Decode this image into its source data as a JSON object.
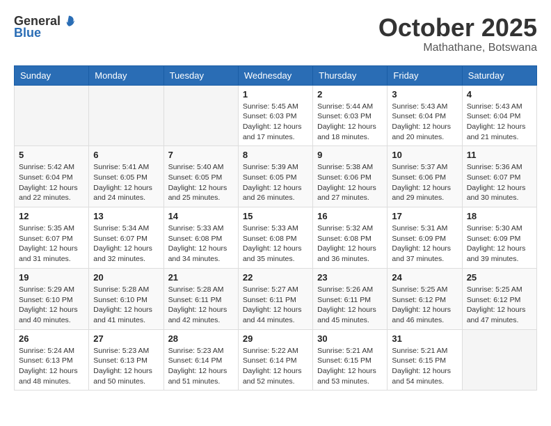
{
  "header": {
    "logo_general": "General",
    "logo_blue": "Blue",
    "month": "October 2025",
    "location": "Mathathane, Botswana"
  },
  "weekdays": [
    "Sunday",
    "Monday",
    "Tuesday",
    "Wednesday",
    "Thursday",
    "Friday",
    "Saturday"
  ],
  "weeks": [
    [
      {
        "day": "",
        "info": ""
      },
      {
        "day": "",
        "info": ""
      },
      {
        "day": "",
        "info": ""
      },
      {
        "day": "1",
        "info": "Sunrise: 5:45 AM\nSunset: 6:03 PM\nDaylight: 12 hours\nand 17 minutes."
      },
      {
        "day": "2",
        "info": "Sunrise: 5:44 AM\nSunset: 6:03 PM\nDaylight: 12 hours\nand 18 minutes."
      },
      {
        "day": "3",
        "info": "Sunrise: 5:43 AM\nSunset: 6:04 PM\nDaylight: 12 hours\nand 20 minutes."
      },
      {
        "day": "4",
        "info": "Sunrise: 5:43 AM\nSunset: 6:04 PM\nDaylight: 12 hours\nand 21 minutes."
      }
    ],
    [
      {
        "day": "5",
        "info": "Sunrise: 5:42 AM\nSunset: 6:04 PM\nDaylight: 12 hours\nand 22 minutes."
      },
      {
        "day": "6",
        "info": "Sunrise: 5:41 AM\nSunset: 6:05 PM\nDaylight: 12 hours\nand 24 minutes."
      },
      {
        "day": "7",
        "info": "Sunrise: 5:40 AM\nSunset: 6:05 PM\nDaylight: 12 hours\nand 25 minutes."
      },
      {
        "day": "8",
        "info": "Sunrise: 5:39 AM\nSunset: 6:05 PM\nDaylight: 12 hours\nand 26 minutes."
      },
      {
        "day": "9",
        "info": "Sunrise: 5:38 AM\nSunset: 6:06 PM\nDaylight: 12 hours\nand 27 minutes."
      },
      {
        "day": "10",
        "info": "Sunrise: 5:37 AM\nSunset: 6:06 PM\nDaylight: 12 hours\nand 29 minutes."
      },
      {
        "day": "11",
        "info": "Sunrise: 5:36 AM\nSunset: 6:07 PM\nDaylight: 12 hours\nand 30 minutes."
      }
    ],
    [
      {
        "day": "12",
        "info": "Sunrise: 5:35 AM\nSunset: 6:07 PM\nDaylight: 12 hours\nand 31 minutes."
      },
      {
        "day": "13",
        "info": "Sunrise: 5:34 AM\nSunset: 6:07 PM\nDaylight: 12 hours\nand 32 minutes."
      },
      {
        "day": "14",
        "info": "Sunrise: 5:33 AM\nSunset: 6:08 PM\nDaylight: 12 hours\nand 34 minutes."
      },
      {
        "day": "15",
        "info": "Sunrise: 5:33 AM\nSunset: 6:08 PM\nDaylight: 12 hours\nand 35 minutes."
      },
      {
        "day": "16",
        "info": "Sunrise: 5:32 AM\nSunset: 6:08 PM\nDaylight: 12 hours\nand 36 minutes."
      },
      {
        "day": "17",
        "info": "Sunrise: 5:31 AM\nSunset: 6:09 PM\nDaylight: 12 hours\nand 37 minutes."
      },
      {
        "day": "18",
        "info": "Sunrise: 5:30 AM\nSunset: 6:09 PM\nDaylight: 12 hours\nand 39 minutes."
      }
    ],
    [
      {
        "day": "19",
        "info": "Sunrise: 5:29 AM\nSunset: 6:10 PM\nDaylight: 12 hours\nand 40 minutes."
      },
      {
        "day": "20",
        "info": "Sunrise: 5:28 AM\nSunset: 6:10 PM\nDaylight: 12 hours\nand 41 minutes."
      },
      {
        "day": "21",
        "info": "Sunrise: 5:28 AM\nSunset: 6:11 PM\nDaylight: 12 hours\nand 42 minutes."
      },
      {
        "day": "22",
        "info": "Sunrise: 5:27 AM\nSunset: 6:11 PM\nDaylight: 12 hours\nand 44 minutes."
      },
      {
        "day": "23",
        "info": "Sunrise: 5:26 AM\nSunset: 6:11 PM\nDaylight: 12 hours\nand 45 minutes."
      },
      {
        "day": "24",
        "info": "Sunrise: 5:25 AM\nSunset: 6:12 PM\nDaylight: 12 hours\nand 46 minutes."
      },
      {
        "day": "25",
        "info": "Sunrise: 5:25 AM\nSunset: 6:12 PM\nDaylight: 12 hours\nand 47 minutes."
      }
    ],
    [
      {
        "day": "26",
        "info": "Sunrise: 5:24 AM\nSunset: 6:13 PM\nDaylight: 12 hours\nand 48 minutes."
      },
      {
        "day": "27",
        "info": "Sunrise: 5:23 AM\nSunset: 6:13 PM\nDaylight: 12 hours\nand 50 minutes."
      },
      {
        "day": "28",
        "info": "Sunrise: 5:23 AM\nSunset: 6:14 PM\nDaylight: 12 hours\nand 51 minutes."
      },
      {
        "day": "29",
        "info": "Sunrise: 5:22 AM\nSunset: 6:14 PM\nDaylight: 12 hours\nand 52 minutes."
      },
      {
        "day": "30",
        "info": "Sunrise: 5:21 AM\nSunset: 6:15 PM\nDaylight: 12 hours\nand 53 minutes."
      },
      {
        "day": "31",
        "info": "Sunrise: 5:21 AM\nSunset: 6:15 PM\nDaylight: 12 hours\nand 54 minutes."
      },
      {
        "day": "",
        "info": ""
      }
    ]
  ]
}
